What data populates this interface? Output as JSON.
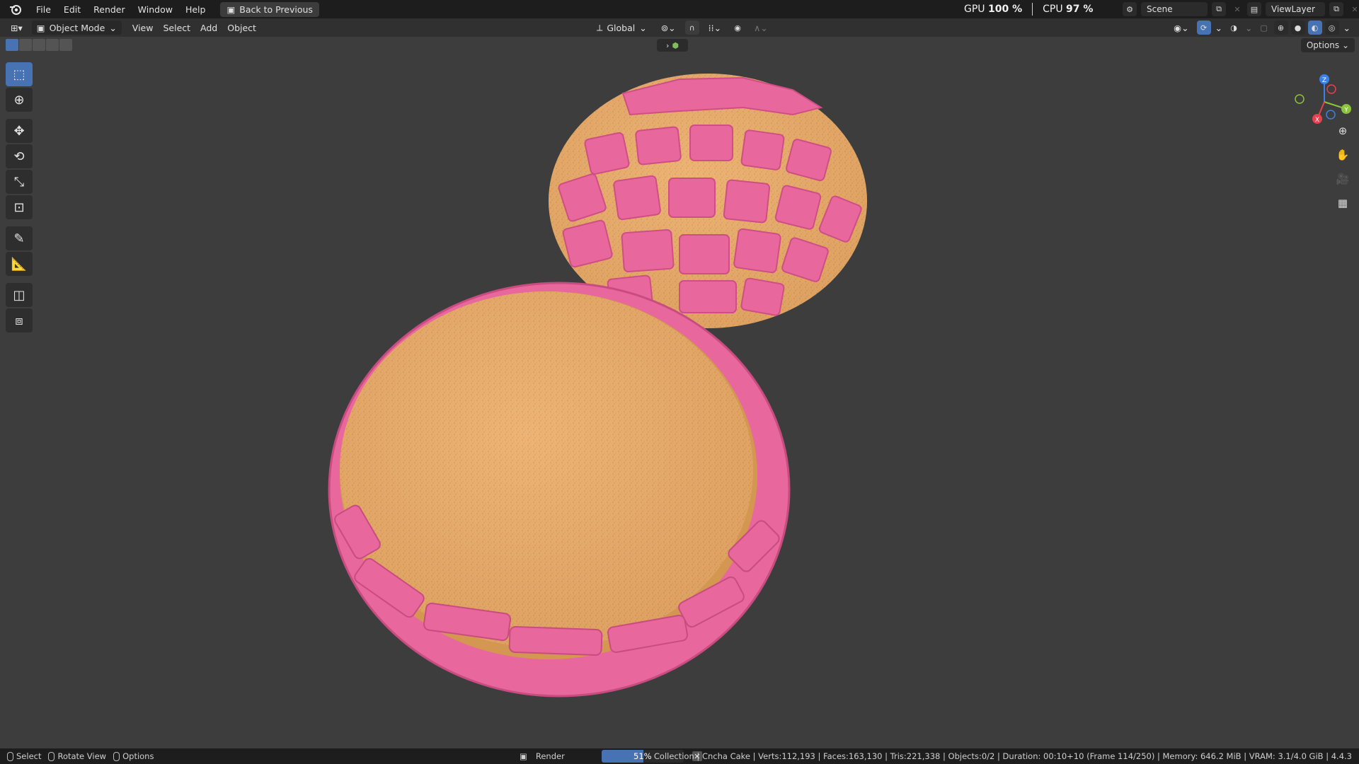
{
  "topbar": {
    "menus": [
      "File",
      "Edit",
      "Render",
      "Window",
      "Help"
    ],
    "back_label": "Back to Previous",
    "gpu_label": "GPU",
    "gpu_value": "100 %",
    "cpu_label": "CPU",
    "cpu_value": "97 %",
    "scene_name": "Scene",
    "view_layer": "ViewLayer"
  },
  "header": {
    "mode": "Object Mode",
    "menus": [
      "View",
      "Select",
      "Add",
      "Object"
    ],
    "orientation": "Global"
  },
  "viewport": {
    "options_label": "Options",
    "gizmo_axes": {
      "x": "X",
      "y": "Y",
      "z": "Z"
    },
    "colors": {
      "x_axis": "#e5414f",
      "y_axis": "#8bc43a",
      "z_axis": "#3a82e5",
      "accent": "#4772b3"
    }
  },
  "statusbar": {
    "hints": [
      "Select",
      "Rotate View",
      "Options"
    ],
    "render_label": "Render",
    "progress_percent": 51,
    "progress_text": "51%",
    "stats": "Collection | Cncha Cake | Verts:112,193 | Faces:163,130 | Tris:221,338 | Objects:0/2 | Duration: 00:10+10 (Frame 114/250) | Memory: 646.2 MiB | VRAM: 3.1/4.0 GiB | 4.4.3"
  }
}
